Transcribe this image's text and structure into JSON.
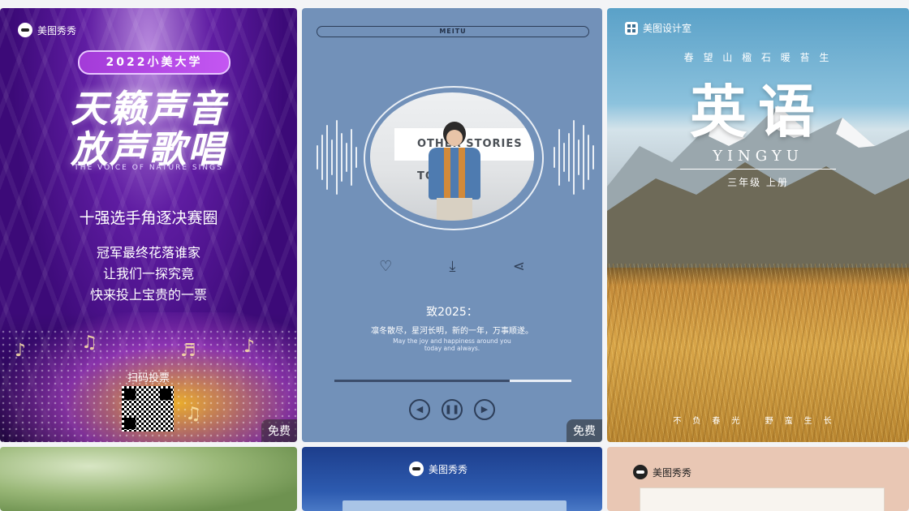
{
  "free_badge": "免费",
  "card1": {
    "brand": "美图秀秀",
    "tag": "2022小美大学",
    "title_line1": "天籁声音",
    "title_line2": "放声歌唱",
    "subtitle": "THE VOICE OF NATURE SINGS",
    "headline": "十强选手角逐决赛圈",
    "line1": "冠军最终花落谁家",
    "line2": "让我们一探究竟",
    "line3": "快来投上宝贵的一票",
    "scan_label": "扫码投票",
    "show_free": true
  },
  "card2": {
    "top_label": "MEITU",
    "wall_text": "OTHER STORIES TO",
    "like_icon": "heart-icon",
    "download_icon": "download-icon",
    "share_icon": "share-icon",
    "title": "致2025：",
    "message": "凛冬散尽，星河长明，新的一年，万事顺遂。",
    "english_line1": "May the joy and happiness around you",
    "english_line2": "today and always.",
    "progress": 0.74,
    "prev_icon": "prev-icon",
    "pause_icon": "pause-icon",
    "next_icon": "next-icon"
  },
  "card3": {
    "brand": "美图设计室",
    "poem": "春 望 山 楹    石 暖 苔 生",
    "big_title": "英语",
    "pinyin": "YINGYU",
    "grade": "三年级 上册",
    "footer": "不负春光 野蛮生长"
  },
  "card5": {
    "brand": "美图秀秀"
  },
  "card6": {
    "brand": "美图秀秀"
  }
}
